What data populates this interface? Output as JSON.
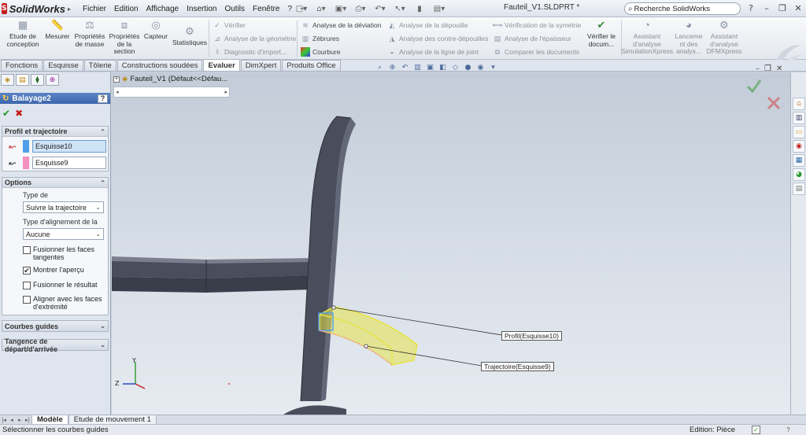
{
  "app": {
    "name": "SolidWorks",
    "document_title": "Fauteil_V1.SLDPRT *"
  },
  "menu": [
    "Fichier",
    "Edition",
    "Affichage",
    "Insertion",
    "Outils",
    "Fenêtre",
    "?"
  ],
  "search": {
    "placeholder": "Recherche SolidWorks"
  },
  "ribbon": {
    "big": [
      {
        "label": "Etude de conception",
        "icon": "design-study-icon"
      },
      {
        "label": "Mesurer",
        "icon": "measure-icon"
      },
      {
        "label": "Propriétés de masse",
        "icon": "mass-properties-icon"
      },
      {
        "label": "Propriétés de la section",
        "icon": "section-properties-icon"
      },
      {
        "label": "Capteur",
        "icon": "sensor-icon"
      },
      {
        "label": "Statistiques",
        "icon": "statistics-icon"
      }
    ],
    "col1": [
      "Vérifier",
      "Analyse de la géométrie",
      "Diagnostic d'import..."
    ],
    "col2": [
      "Analyse de la déviation",
      "Zébrures",
      "Courbure"
    ],
    "col3": [
      "Analyse de la dépouille",
      "Analyse des contre-dépouilles",
      "Analyse de la ligne de joint"
    ],
    "col4": [
      "Vérification de la symétrie",
      "Analyse de l'épaisseur",
      "Comparer les documents"
    ],
    "verify_doc": "Vérifier le docum...",
    "assist": [
      {
        "label": "Assistant d'analyse SimulationXpress"
      },
      {
        "label": "Lanceme nt des analys..."
      },
      {
        "label": "Assistant d'analyse DFMXpress"
      }
    ]
  },
  "tabs": [
    "Fonctions",
    "Esquisse",
    "Tôlerie",
    "Constructions soudées",
    "Evaluer",
    "DimXpert",
    "Produits Office"
  ],
  "active_tab": "Evaluer",
  "property_manager": {
    "title": "Balayage2",
    "help": "?",
    "profile_group": {
      "title": "Profil et trajectoire",
      "profile_value": "Esquisse10",
      "path_value": "Esquisse9",
      "profile_color": "#4f9ee8",
      "path_color": "#f48fc0"
    },
    "options_group": {
      "title": "Options",
      "type_label": "Type de",
      "type_value": "Suivre la trajectoire",
      "align_label": "Type d'alignement de la",
      "align_value": "Aucune",
      "checkboxes": [
        {
          "label": "Fusionner les faces tangentes",
          "checked": false
        },
        {
          "label": "Montrer l'aperçu",
          "checked": true
        },
        {
          "label": "Fusionner le résultat",
          "checked": false
        },
        {
          "label": "Aligner avec les faces d'extrémité",
          "checked": false
        }
      ]
    },
    "guide_group": {
      "title": "Courbes guides"
    },
    "tangency_group": {
      "title": "Tangence de départ/d'arrivée"
    }
  },
  "feature_tree": {
    "root": "Fauteil_V1",
    "config": "(Défaut<<Défau..."
  },
  "callouts": {
    "profile": "Profil(Esquisse10)",
    "path": "Trajectoire(Esquisse9)"
  },
  "bottom_tabs": [
    "Modèle",
    "Etude de mouvement 1"
  ],
  "status": {
    "message": "Sélectionner les courbes guides",
    "mode": "Edition: Pièce"
  },
  "colors": {
    "accent": "#3c66ad",
    "preview": "#e6e34a",
    "chair": "#4a4e5c"
  }
}
